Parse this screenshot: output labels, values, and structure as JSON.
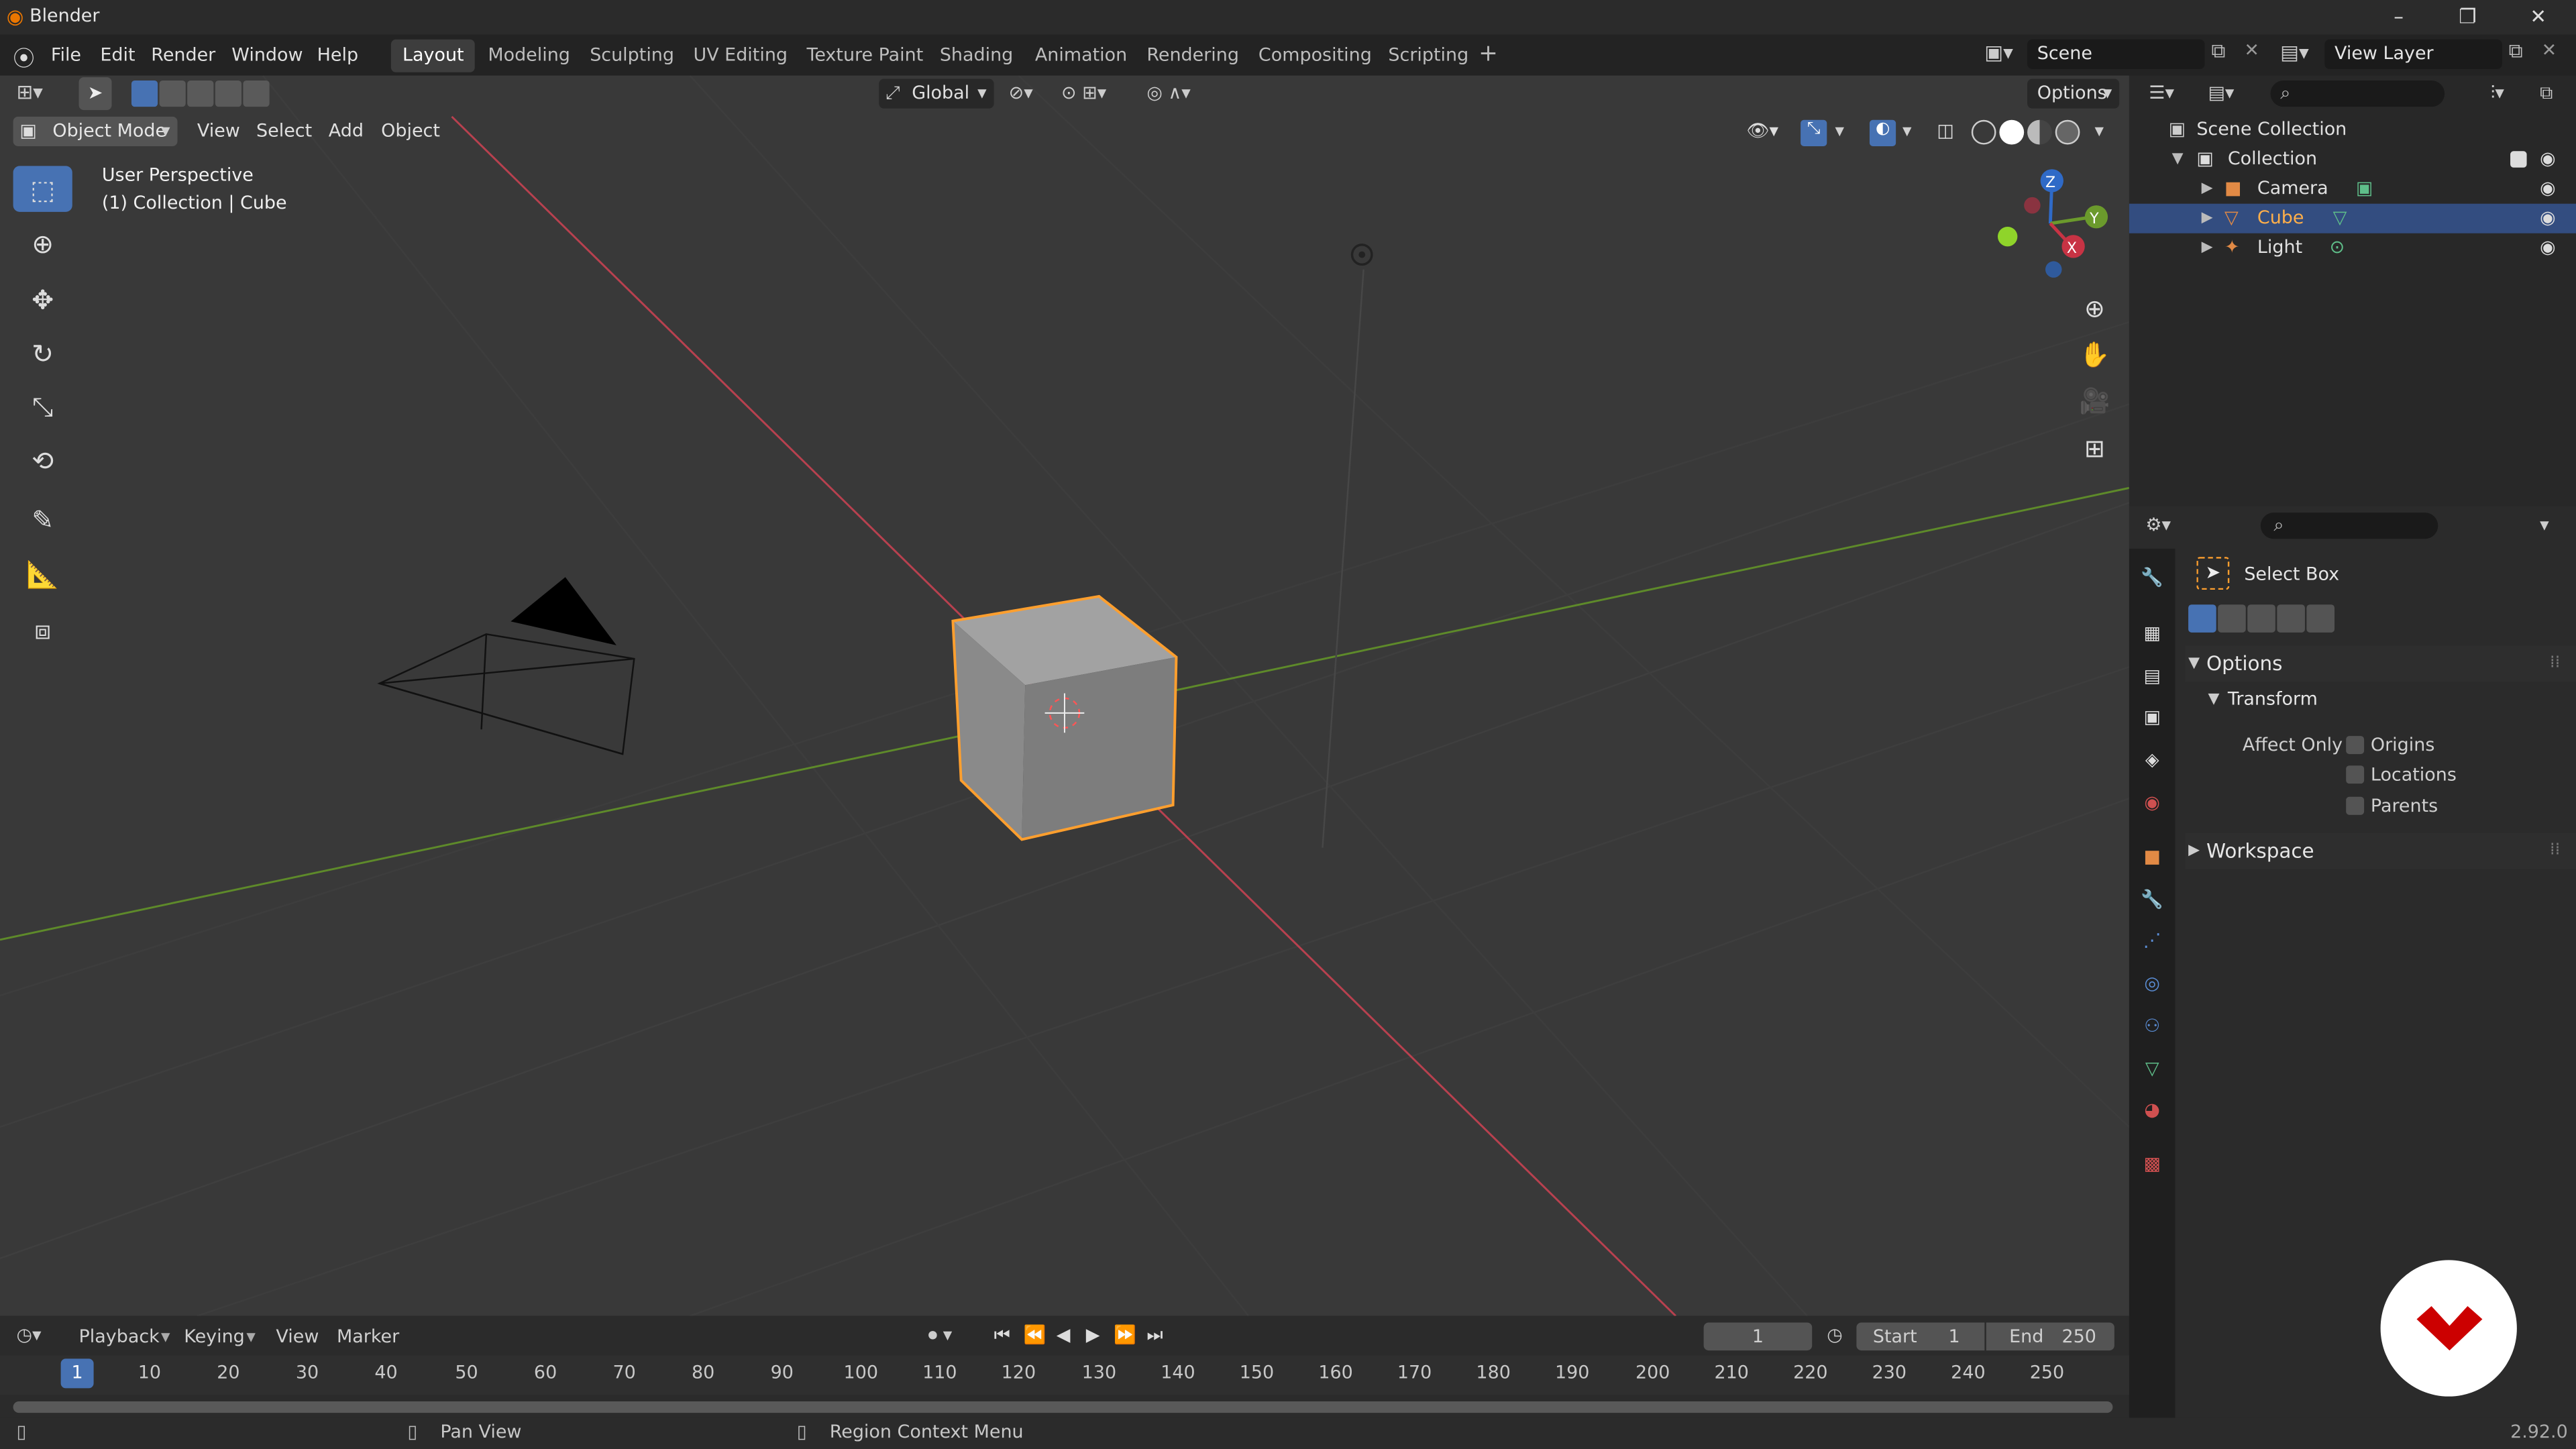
{
  "window": {
    "title": "Blender",
    "minimize": "–",
    "maximize": "❐",
    "close": "✕"
  },
  "menu": [
    "File",
    "Edit",
    "Render",
    "Window",
    "Help"
  ],
  "workspaces": [
    "Layout",
    "Modeling",
    "Sculpting",
    "UV Editing",
    "Texture Paint",
    "Shading",
    "Animation",
    "Rendering",
    "Compositing",
    "Scripting"
  ],
  "active_workspace": "Layout",
  "scene": {
    "label": "Scene",
    "view_layer": "View Layer"
  },
  "tool_header": {
    "orientation": "Global",
    "options": "Options"
  },
  "viewport": {
    "mode": "Object Mode",
    "menus": [
      "View",
      "Select",
      "Add",
      "Object"
    ],
    "info_line1": "User Perspective",
    "info_line2": "(1) Collection | Cube",
    "gizmo": {
      "x": "X",
      "y": "Y",
      "z": "Z"
    }
  },
  "outliner": {
    "root": "Scene Collection",
    "collection": "Collection",
    "items": [
      {
        "name": "Camera",
        "selected": false
      },
      {
        "name": "Cube",
        "selected": true
      },
      {
        "name": "Light",
        "selected": false
      }
    ]
  },
  "properties": {
    "tool_name": "Select Box",
    "options_panel": "Options",
    "transform_panel": "Transform",
    "affect_only": "Affect Only",
    "checks": [
      "Origins",
      "Locations",
      "Parents"
    ],
    "workspace_panel": "Workspace"
  },
  "timeline": {
    "menus": [
      "Playback",
      "Keying",
      "View",
      "Marker"
    ],
    "current_frame": "1",
    "start_label": "Start",
    "start": "1",
    "end_label": "End",
    "end": "250",
    "ticks": [
      "1",
      "10",
      "20",
      "30",
      "40",
      "50",
      "60",
      "70",
      "80",
      "90",
      "100",
      "110",
      "120",
      "130",
      "140",
      "150",
      "160",
      "170",
      "180",
      "190",
      "200",
      "210",
      "220",
      "230",
      "240",
      "250"
    ]
  },
  "statusbar": {
    "hint1": "Pan View",
    "hint2": "Region Context Menu",
    "version": "2.92.0"
  },
  "colors": {
    "accent": "#4772b3",
    "selection": "#ff9f2e",
    "x_axis": "#c83344",
    "y_axis": "#6b9a2c",
    "z_axis": "#2f6ac7",
    "logo": "#cc0000"
  }
}
